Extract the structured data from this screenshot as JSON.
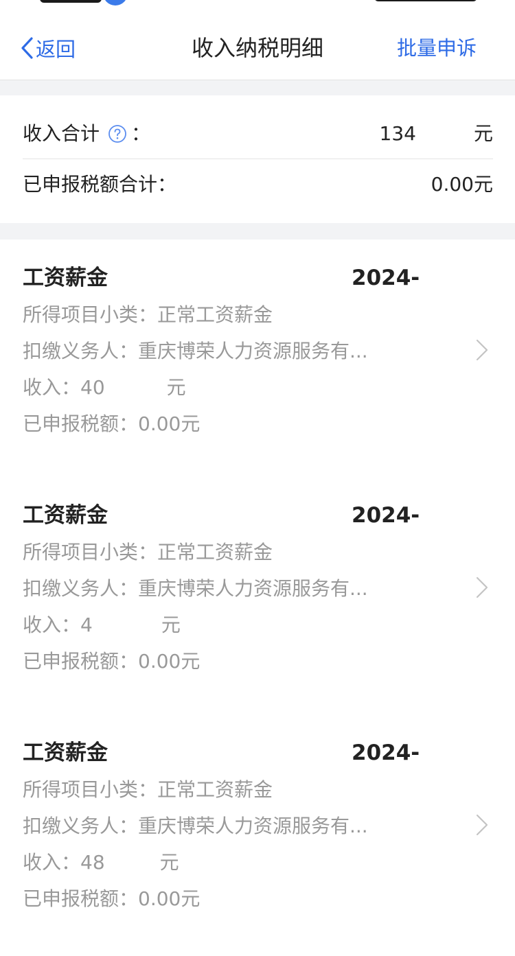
{
  "nav": {
    "back_label": "返回",
    "title": "收入纳税明细",
    "right_action": "批量申诉"
  },
  "summary": {
    "income_total_label": "收入合计",
    "colon": "：",
    "income_total_value": "134",
    "income_total_unit": "元",
    "tax_total_label": "已申报税额合计：",
    "tax_total_value": "0.00元"
  },
  "records": [
    {
      "type": "工资薪金",
      "date": "2024-",
      "subcategory": "所得项目小类：正常工资薪金",
      "withholder": "扣缴义务人：重庆博荣人力资源服务有...",
      "income_label": "收入：",
      "income_value": "40",
      "income_unit": "元",
      "tax": "已申报税额：0.00元"
    },
    {
      "type": "工资薪金",
      "date": "2024-",
      "subcategory": "所得项目小类：正常工资薪金",
      "withholder": "扣缴义务人：重庆博荣人力资源服务有...",
      "income_label": "收入：",
      "income_value": "4",
      "income_unit": "元",
      "tax": "已申报税额：0.00元"
    },
    {
      "type": "工资薪金",
      "date": "2024-",
      "subcategory": "所得项目小类：正常工资薪金",
      "withholder": "扣缴义务人：重庆博荣人力资源服务有...",
      "income_label": "收入：",
      "income_value": "48",
      "income_unit": "元",
      "tax": "已申报税额：0.00元"
    }
  ],
  "colors": {
    "accent": "#2e6be6",
    "primary_text": "#222222",
    "secondary_text": "#999999",
    "page_gap": "#f2f3f5"
  },
  "icons": {
    "back": "chevron-left-icon",
    "help": "question-circle-icon",
    "row_arrow": "chevron-right-icon"
  }
}
